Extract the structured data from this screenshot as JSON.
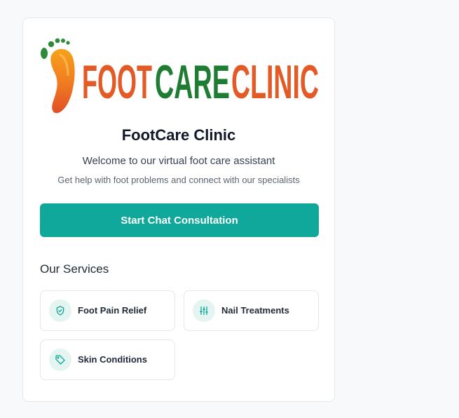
{
  "logo": {
    "word_1": "FOOT",
    "word_2": "CARE",
    "word_3": "CLINIC"
  },
  "clinic": {
    "title": "FootCare Clinic",
    "welcome": "Welcome to our virtual foot care assistant",
    "subtext": "Get help with foot problems and connect with our specialists"
  },
  "cta": {
    "label": "Start Chat Consultation"
  },
  "services": {
    "heading": "Our Services",
    "items": [
      {
        "label": "Foot Pain Relief",
        "icon": "shield-icon"
      },
      {
        "label": "Nail Treatments",
        "icon": "sliders-icon"
      },
      {
        "label": "Skin Conditions",
        "icon": "tag-icon"
      }
    ]
  },
  "colors": {
    "accent": "#0fa89a",
    "logo_orange": "#e35a27",
    "logo_green": "#1e7d32",
    "icon_bg": "#e3f4f1"
  }
}
